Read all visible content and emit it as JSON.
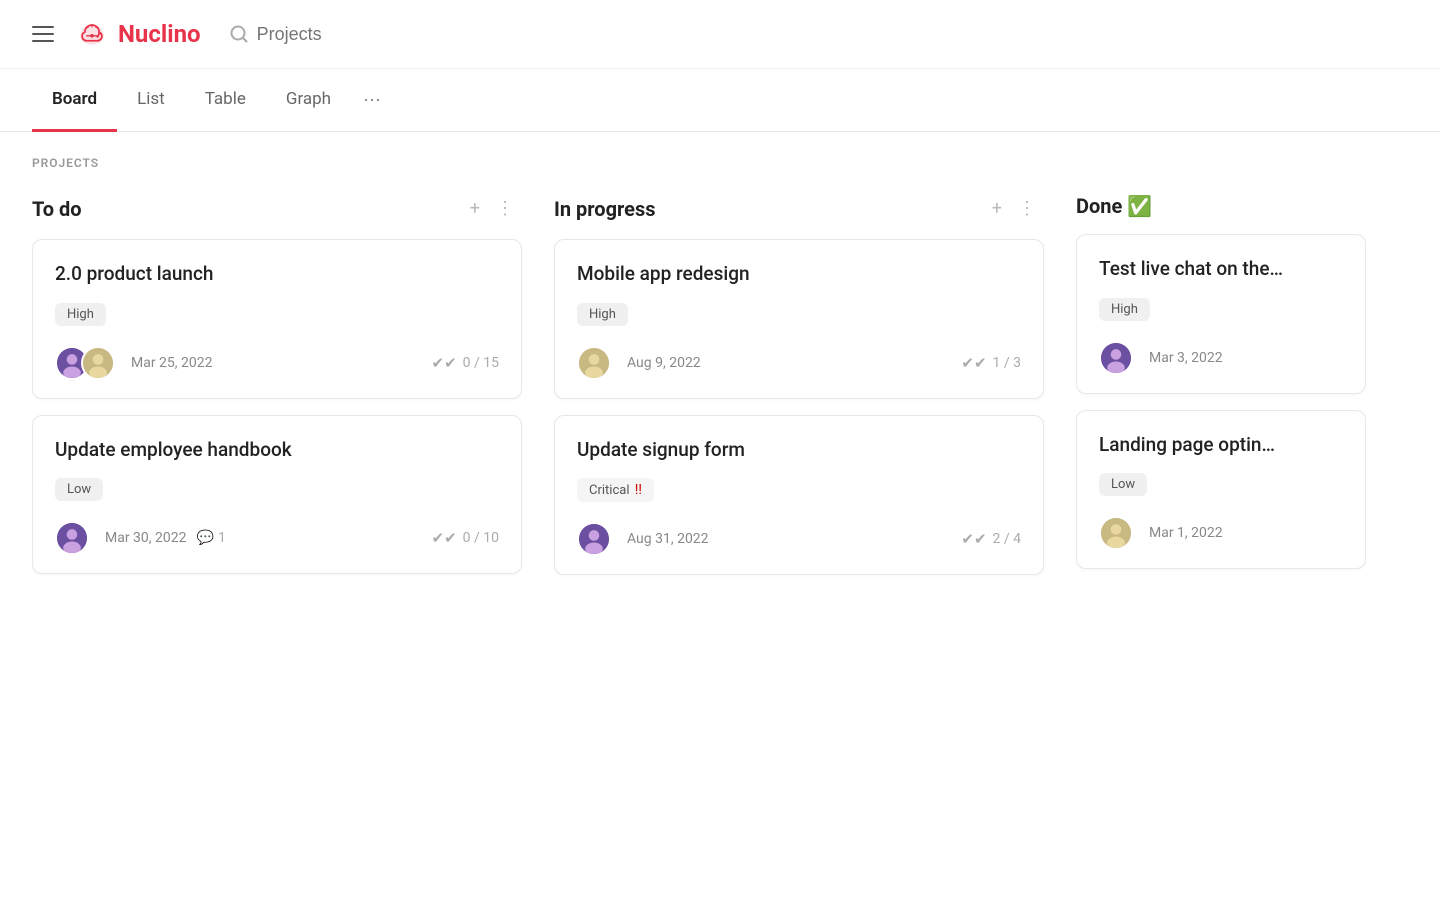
{
  "app": {
    "name": "Nuclino",
    "search_placeholder": "Projects"
  },
  "tabs": [
    {
      "id": "board",
      "label": "Board",
      "active": true
    },
    {
      "id": "list",
      "label": "List",
      "active": false
    },
    {
      "id": "table",
      "label": "Table",
      "active": false
    },
    {
      "id": "graph",
      "label": "Graph",
      "active": false
    }
  ],
  "section_label": "PROJECTS",
  "columns": [
    {
      "id": "todo",
      "title": "To do",
      "emoji": "",
      "cards": [
        {
          "title": "2.0 product launch",
          "badge": "High",
          "badge_type": "normal",
          "avatars": [
            "purple",
            "beige"
          ],
          "date": "Mar 25, 2022",
          "checks": "0 / 15",
          "comments": null
        },
        {
          "title": "Update employee handbook",
          "badge": "Low",
          "badge_type": "normal",
          "avatars": [
            "purple"
          ],
          "date": "Mar 30, 2022",
          "checks": "0 / 10",
          "comments": "1"
        }
      ]
    },
    {
      "id": "inprogress",
      "title": "In progress",
      "emoji": "",
      "cards": [
        {
          "title": "Mobile app redesign",
          "badge": "High",
          "badge_type": "normal",
          "avatars": [
            "beige"
          ],
          "date": "Aug 9, 2022",
          "checks": "1 / 3",
          "comments": null
        },
        {
          "title": "Update signup form",
          "badge": "Critical",
          "badge_type": "critical",
          "avatars": [
            "purple"
          ],
          "date": "Aug 31, 2022",
          "checks": "2 / 4",
          "comments": null
        }
      ]
    },
    {
      "id": "done",
      "title": "Done",
      "emoji": "✅",
      "cards": [
        {
          "title": "Test live chat on the…",
          "badge": "High",
          "badge_type": "normal",
          "avatars": [
            "purple"
          ],
          "date": "Mar 3, 2022",
          "checks": null,
          "comments": null
        },
        {
          "title": "Landing page optin…",
          "badge": "Low",
          "badge_type": "normal",
          "avatars": [
            "beige"
          ],
          "date": "Mar 1, 2022",
          "checks": null,
          "comments": null
        }
      ]
    }
  ]
}
